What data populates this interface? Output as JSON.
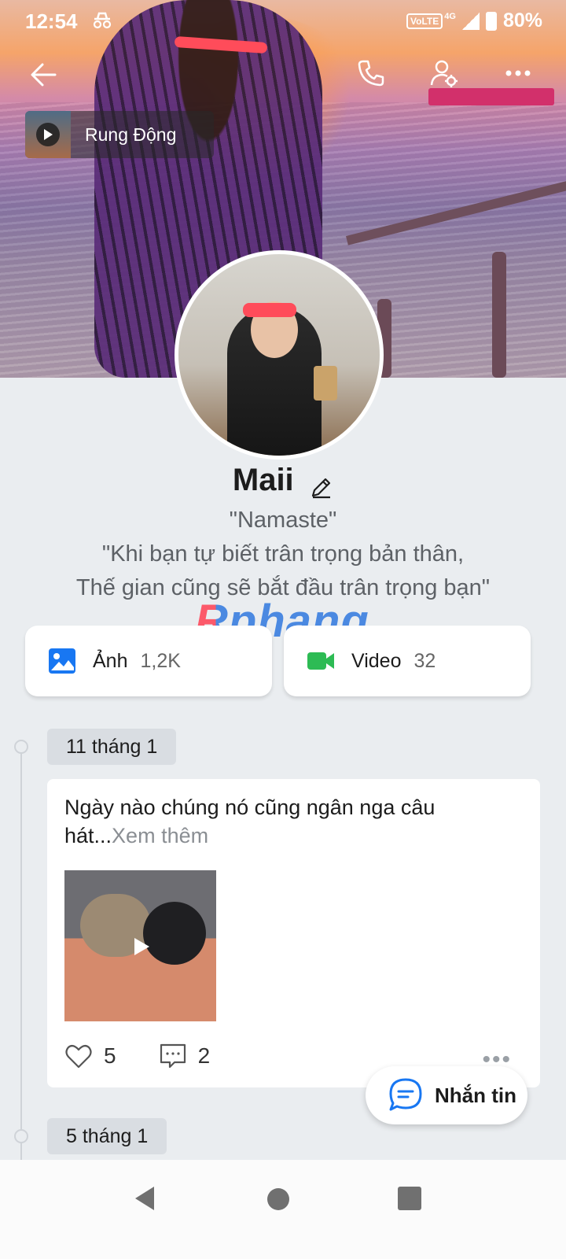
{
  "status_bar": {
    "time": "12:54",
    "volte": "VoLTE",
    "network": "4G",
    "battery": "80%"
  },
  "icons": {
    "back": "arrow-left-icon",
    "call": "phone-icon",
    "profile_settings": "user-gear-icon",
    "more": "more-horizontal-icon"
  },
  "music": {
    "title": "Rung Động"
  },
  "profile": {
    "name": "Maii",
    "bio_lines": [
      "\"Namaste\"",
      "\"Khi bạn tự biết trân trọng bản thân,",
      "Thế gian cũng sẽ bắt đầu trân trọng bạn\""
    ]
  },
  "watermark": {
    "text": "Rphang"
  },
  "media": {
    "photos": {
      "label": "Ảnh",
      "count": "1,2K",
      "color": "#1877f2"
    },
    "videos": {
      "label": "Video",
      "count": "32",
      "color": "#2dbb54"
    }
  },
  "timeline": [
    {
      "date": "11 tháng 1",
      "text": "Ngày nào chúng nó cũng ngân nga câu hát...",
      "see_more": "Xem thêm",
      "likes": "5",
      "comments": "2"
    },
    {
      "date": "5 tháng 1"
    }
  ],
  "message_button": {
    "label": "Nhắn tin",
    "color": "#1877f2"
  }
}
